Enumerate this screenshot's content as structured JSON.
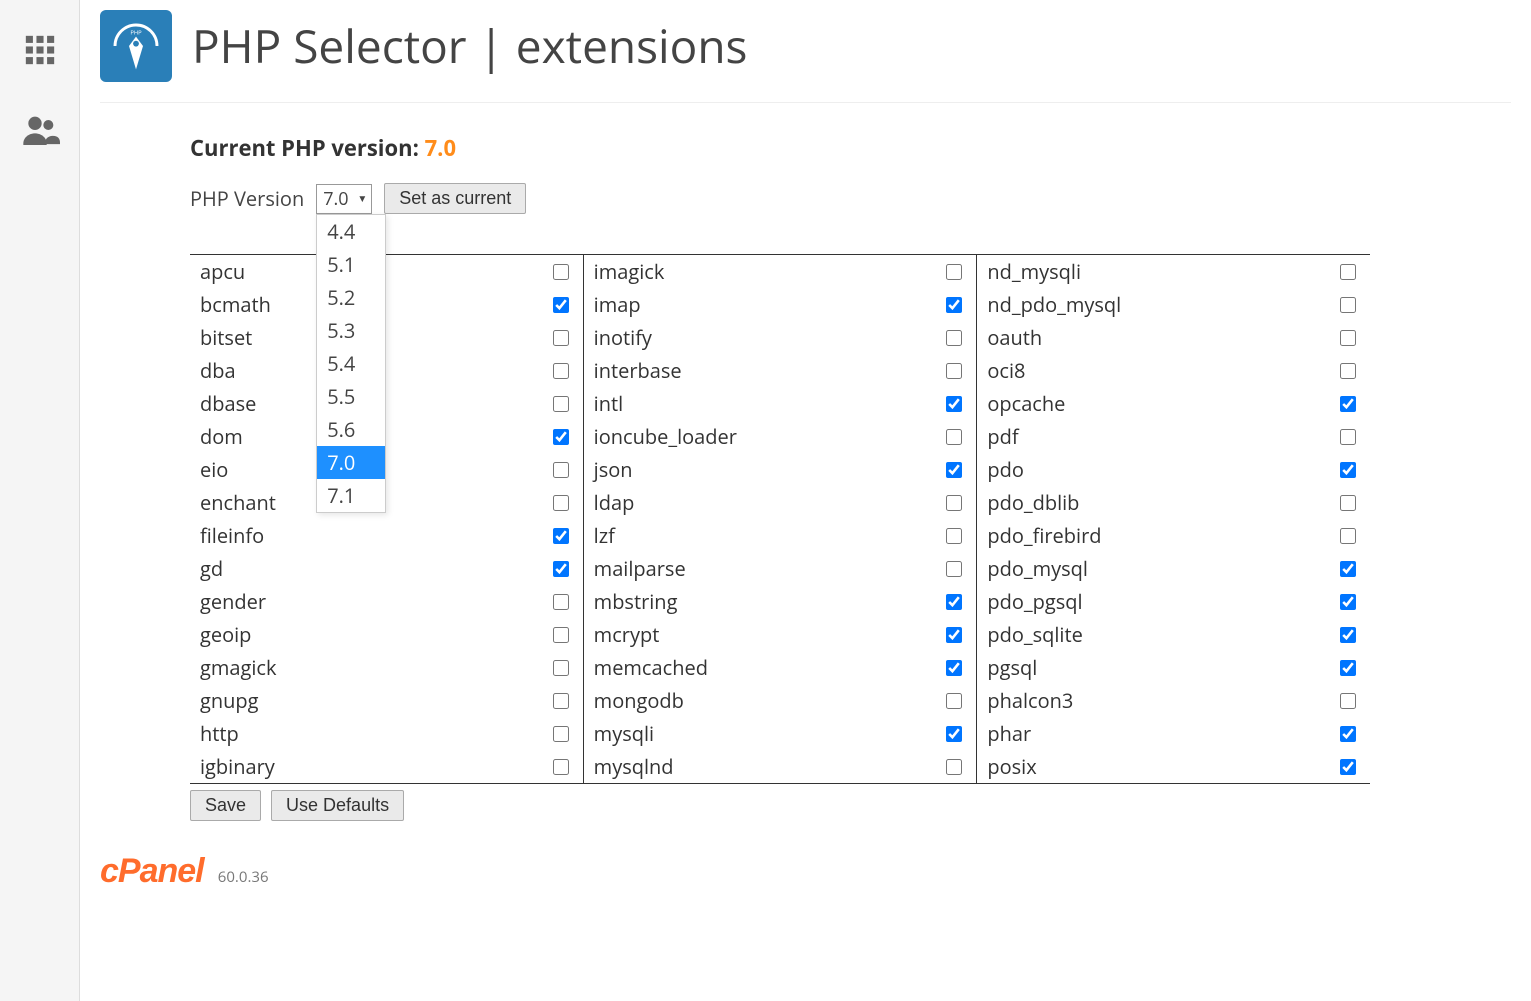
{
  "page_title": "PHP Selector | extensions",
  "current_label": "Current PHP version:",
  "current_value": "7.0",
  "version_label": "PHP Version",
  "select_display": "7.0",
  "select_options": [
    "4.4",
    "5.1",
    "5.2",
    "5.3",
    "5.4",
    "5.5",
    "5.6",
    "7.0",
    "7.1"
  ],
  "select_selected": "7.0",
  "set_current_button": "Set as current",
  "save_button": "Save",
  "defaults_button": "Use Defaults",
  "footer_brand": "cPanel",
  "footer_version": "60.0.36",
  "extensions": {
    "col1": [
      {
        "name": "apcu",
        "checked": false
      },
      {
        "name": "bcmath",
        "checked": true
      },
      {
        "name": "bitset",
        "checked": false
      },
      {
        "name": "dba",
        "checked": false
      },
      {
        "name": "dbase",
        "checked": false
      },
      {
        "name": "dom",
        "checked": true
      },
      {
        "name": "eio",
        "checked": false
      },
      {
        "name": "enchant",
        "checked": false
      },
      {
        "name": "fileinfo",
        "checked": true
      },
      {
        "name": "gd",
        "checked": true
      },
      {
        "name": "gender",
        "checked": false
      },
      {
        "name": "geoip",
        "checked": false
      },
      {
        "name": "gmagick",
        "checked": false
      },
      {
        "name": "gnupg",
        "checked": false
      },
      {
        "name": "http",
        "checked": false
      },
      {
        "name": "igbinary",
        "checked": false
      }
    ],
    "col2": [
      {
        "name": "imagick",
        "checked": false
      },
      {
        "name": "imap",
        "checked": true
      },
      {
        "name": "inotify",
        "checked": false
      },
      {
        "name": "interbase",
        "checked": false
      },
      {
        "name": "intl",
        "checked": true
      },
      {
        "name": "ioncube_loader",
        "checked": false
      },
      {
        "name": "json",
        "checked": true
      },
      {
        "name": "ldap",
        "checked": false
      },
      {
        "name": "lzf",
        "checked": false
      },
      {
        "name": "mailparse",
        "checked": false
      },
      {
        "name": "mbstring",
        "checked": true
      },
      {
        "name": "mcrypt",
        "checked": true
      },
      {
        "name": "memcached",
        "checked": true
      },
      {
        "name": "mongodb",
        "checked": false
      },
      {
        "name": "mysqli",
        "checked": true
      },
      {
        "name": "mysqlnd",
        "checked": false
      }
    ],
    "col3": [
      {
        "name": "nd_mysqli",
        "checked": false
      },
      {
        "name": "nd_pdo_mysql",
        "checked": false
      },
      {
        "name": "oauth",
        "checked": false
      },
      {
        "name": "oci8",
        "checked": false
      },
      {
        "name": "opcache",
        "checked": true
      },
      {
        "name": "pdf",
        "checked": false
      },
      {
        "name": "pdo",
        "checked": true
      },
      {
        "name": "pdo_dblib",
        "checked": false
      },
      {
        "name": "pdo_firebird",
        "checked": false
      },
      {
        "name": "pdo_mysql",
        "checked": true
      },
      {
        "name": "pdo_pgsql",
        "checked": true
      },
      {
        "name": "pdo_sqlite",
        "checked": true
      },
      {
        "name": "pgsql",
        "checked": true
      },
      {
        "name": "phalcon3",
        "checked": false
      },
      {
        "name": "phar",
        "checked": true
      },
      {
        "name": "posix",
        "checked": true
      }
    ]
  }
}
